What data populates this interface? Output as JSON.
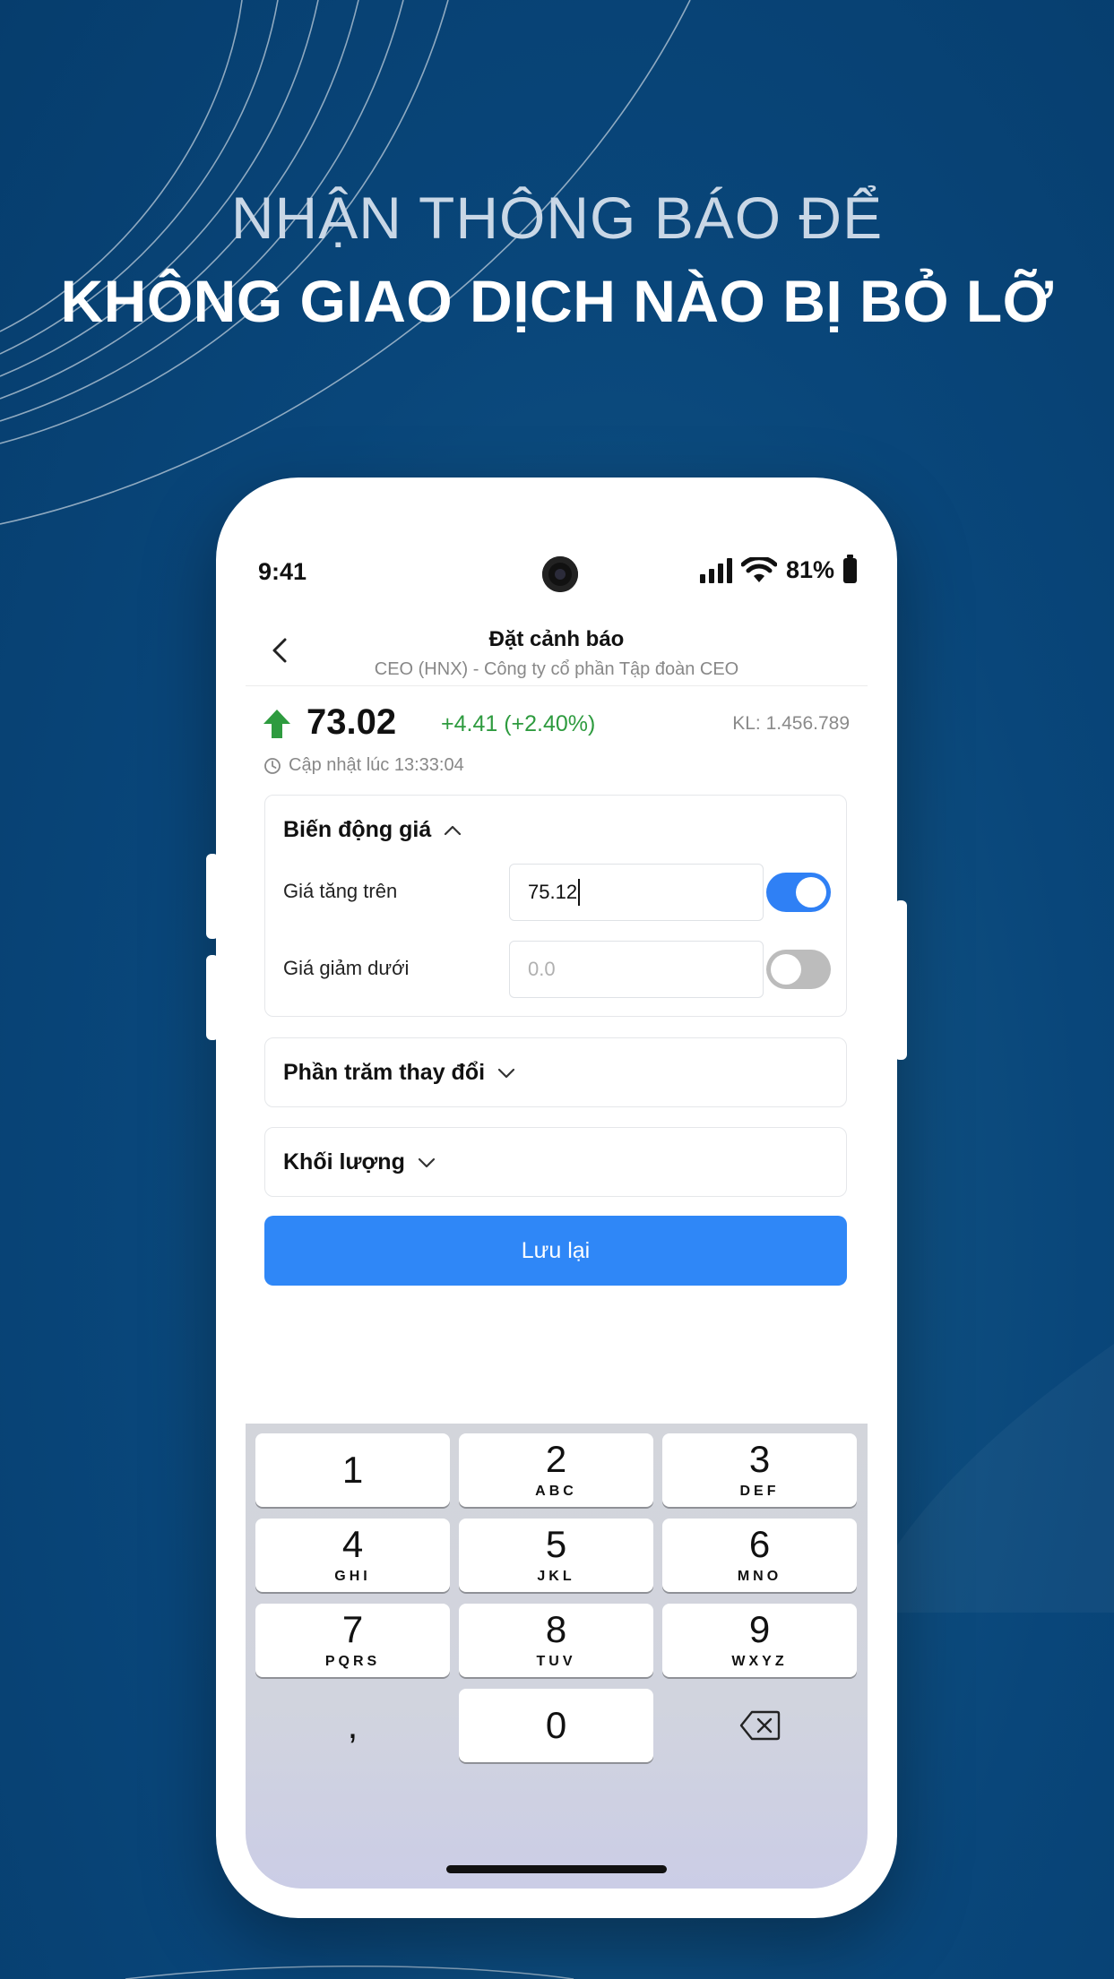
{
  "headline": {
    "line1": "NHẬN THÔNG BÁO ĐỂ",
    "line2": "KHÔNG GIAO DỊCH NÀO BỊ BỎ LỠ"
  },
  "status_bar": {
    "time": "9:41",
    "battery": "81%"
  },
  "nav": {
    "title": "Đặt cảnh báo",
    "subtitle": "CEO (HNX) - Công ty cổ phần Tập đoàn CEO"
  },
  "quote": {
    "price": "73.02",
    "change": "+4.41 (+2.40%)",
    "volume": "KL: 1.456.789",
    "updated": "Cập nhật lúc 13:33:04",
    "colors": {
      "up": "#2e9b3f"
    }
  },
  "sections": {
    "price_move": {
      "title": "Biến động giá",
      "expanded": true,
      "rise_label": "Giá tăng trên",
      "rise_value": "75.12",
      "rise_enabled": true,
      "fall_label": "Giá giảm dưới",
      "fall_placeholder": "0.0",
      "fall_enabled": false
    },
    "percent_change": {
      "title": "Phần trăm thay đổi",
      "expanded": false
    },
    "volume": {
      "title": "Khối lượng",
      "expanded": false
    }
  },
  "save_label": "Lưu lại",
  "keyboard": {
    "keys": [
      {
        "num": "1",
        "sub": ""
      },
      {
        "num": "2",
        "sub": "ABC"
      },
      {
        "num": "3",
        "sub": "DEF"
      },
      {
        "num": "4",
        "sub": "GHI"
      },
      {
        "num": "5",
        "sub": "JKL"
      },
      {
        "num": "6",
        "sub": "MNO"
      },
      {
        "num": "7",
        "sub": "PQRS"
      },
      {
        "num": "8",
        "sub": "TUV"
      },
      {
        "num": "9",
        "sub": "WXYZ"
      },
      {
        "num": ",",
        "sub": ""
      },
      {
        "num": "0",
        "sub": ""
      }
    ],
    "delete_icon": "backspace-icon"
  },
  "theme": {
    "accent": "#2f87f7",
    "background": "#09467a"
  }
}
